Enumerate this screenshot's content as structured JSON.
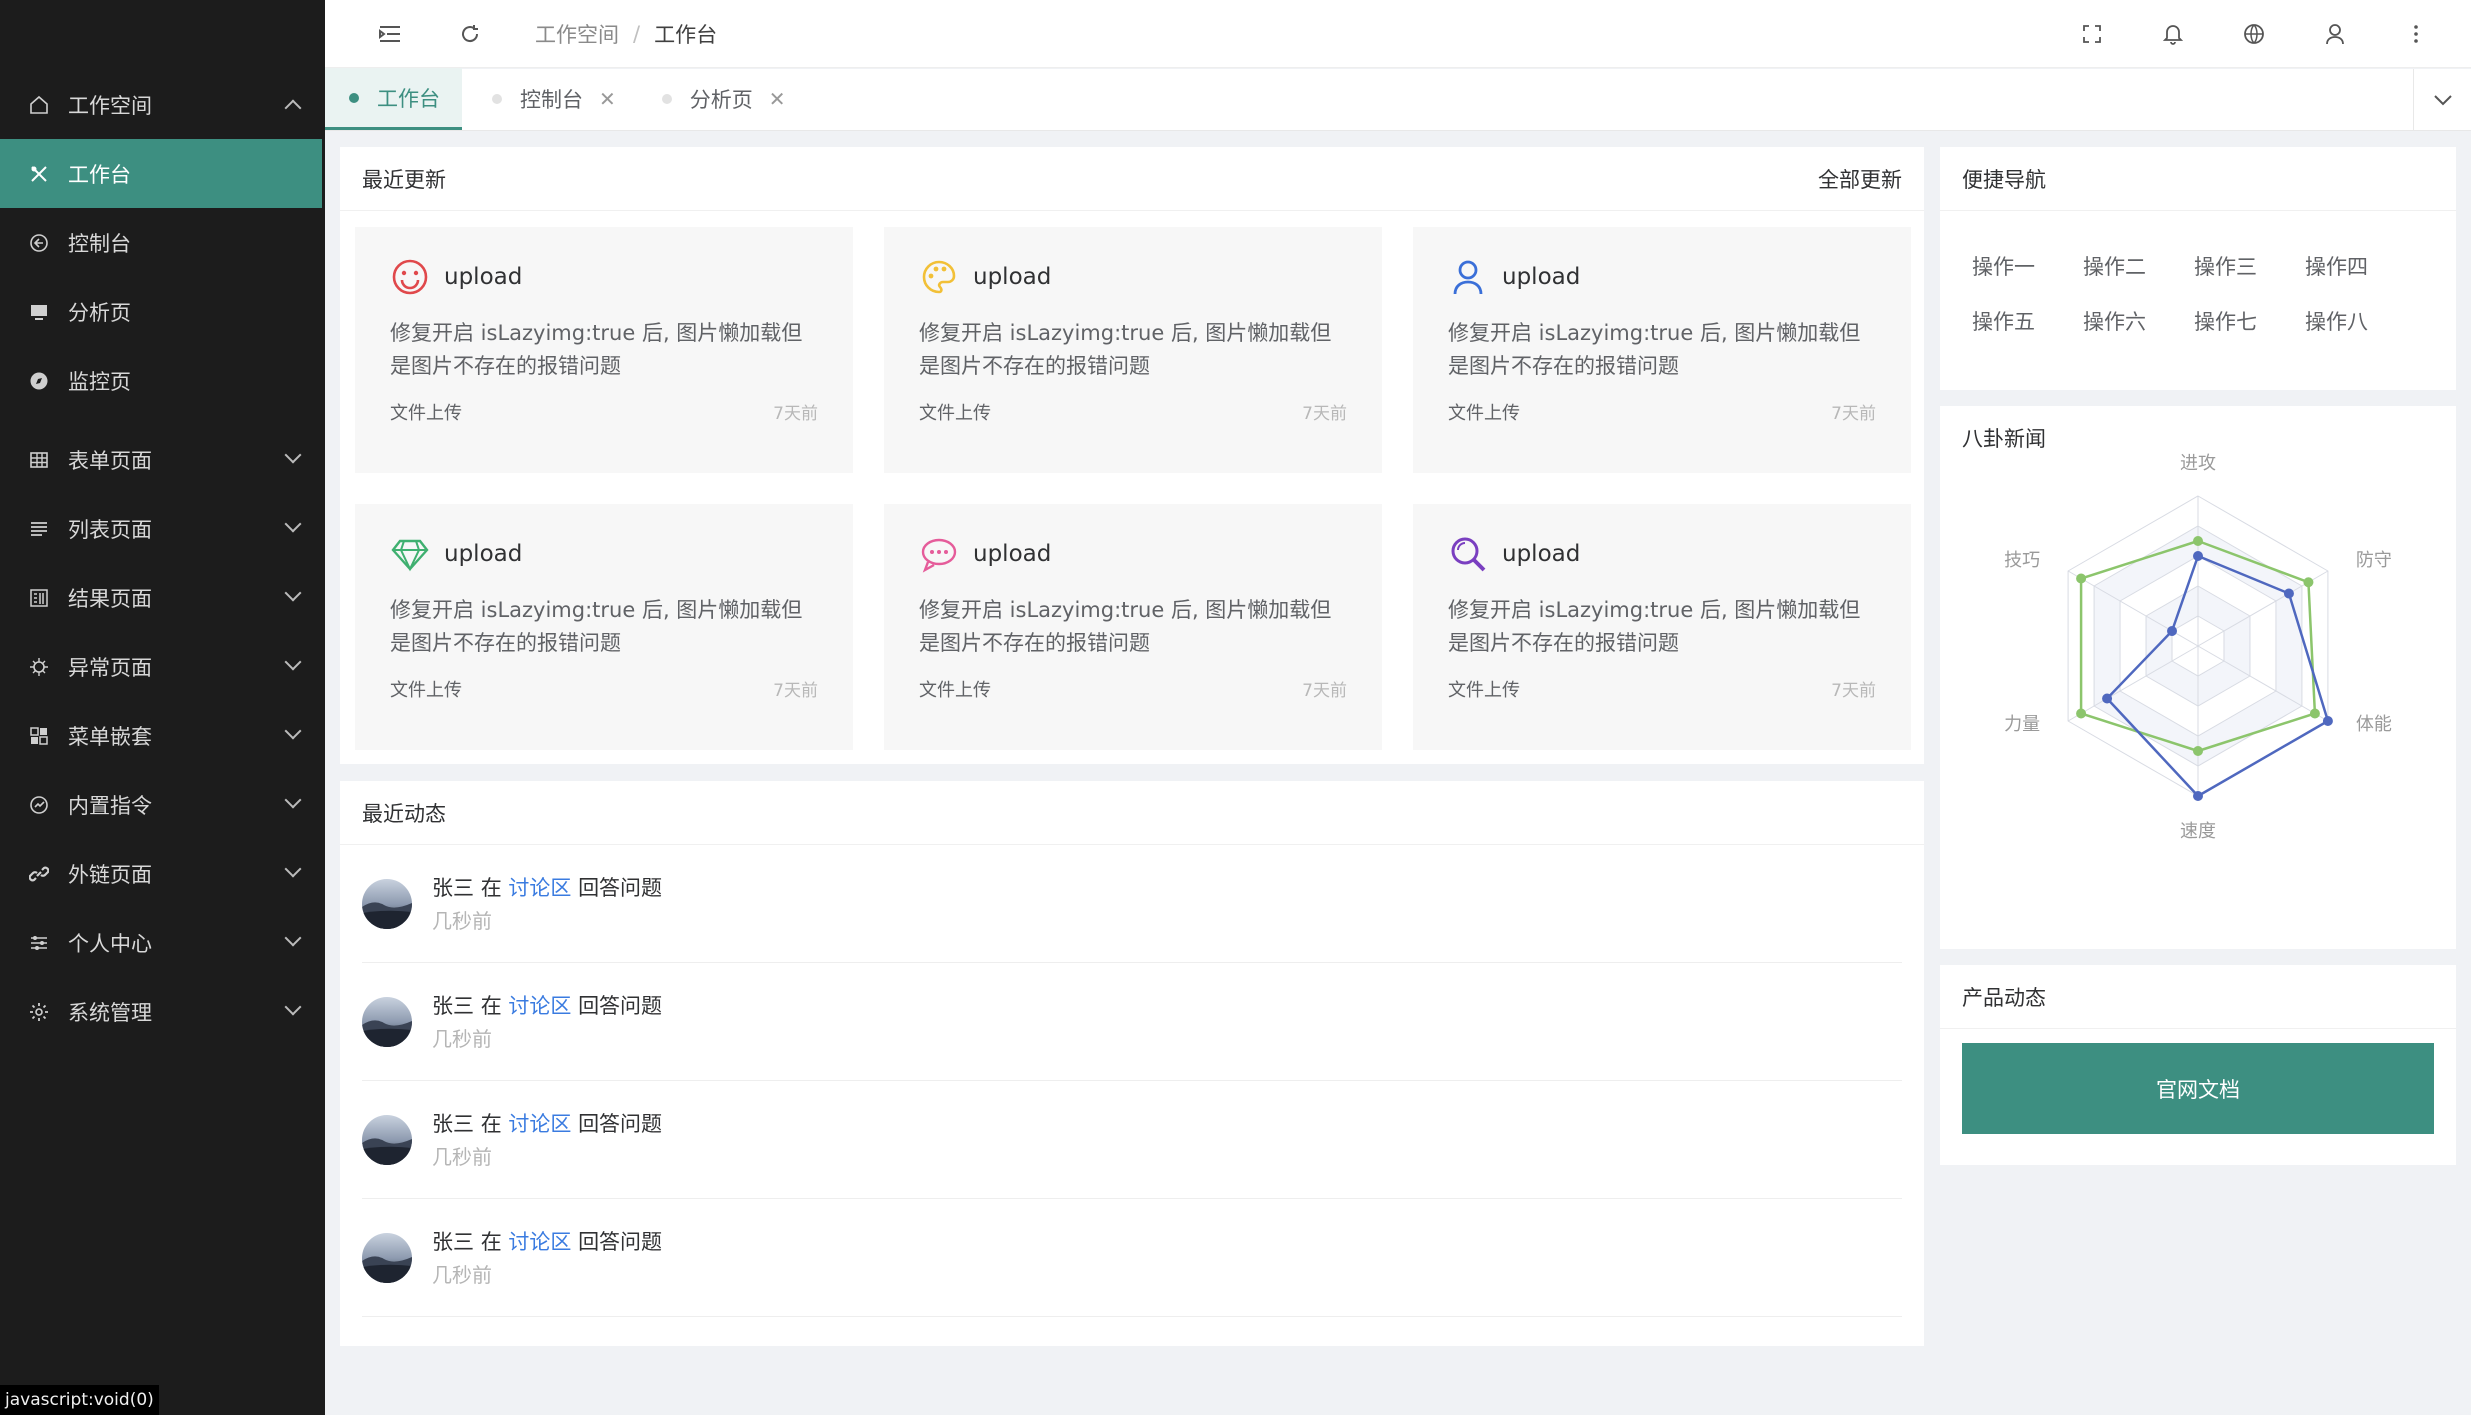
{
  "sidebar": {
    "items": [
      {
        "label": "工作空间",
        "icon": "home-icon",
        "expandable": true,
        "expanded": true
      },
      {
        "label": "工作台",
        "icon": "tools-icon",
        "active": true
      },
      {
        "label": "控制台",
        "icon": "console-icon"
      },
      {
        "label": "分析页",
        "icon": "chart-icon"
      },
      {
        "label": "监控页",
        "icon": "compass-icon"
      },
      {
        "label": "表单页面",
        "icon": "table-icon",
        "expandable": true
      },
      {
        "label": "列表页面",
        "icon": "list-icon",
        "expandable": true
      },
      {
        "label": "结果页面",
        "icon": "result-icon",
        "expandable": true
      },
      {
        "label": "异常页面",
        "icon": "bug-icon",
        "expandable": true
      },
      {
        "label": "菜单嵌套",
        "icon": "apps-icon",
        "expandable": true
      },
      {
        "label": "内置指令",
        "icon": "gauge-icon",
        "expandable": true
      },
      {
        "label": "外链页面",
        "icon": "link-icon",
        "expandable": true
      },
      {
        "label": "个人中心",
        "icon": "sliders-icon",
        "expandable": true
      },
      {
        "label": "系统管理",
        "icon": "settings-icon",
        "expandable": true
      }
    ],
    "status_tip": "javascript:void(0)"
  },
  "header": {
    "breadcrumb": [
      "工作空间",
      "工作台"
    ],
    "icons": [
      "fullscreen-icon",
      "bell-icon",
      "globe-icon",
      "user-icon",
      "more-vertical-icon"
    ]
  },
  "tabs": [
    {
      "label": "工作台",
      "active": true
    },
    {
      "label": "控制台",
      "closable": true
    },
    {
      "label": "分析页",
      "closable": true
    }
  ],
  "recent_updates": {
    "title": "最近更新",
    "extra": "全部更新",
    "cards": [
      {
        "title": "upload",
        "icon": "smile-icon",
        "color": "#e0484b",
        "desc": "修复开启 isLazyimg:true 后, 图片懒加载但是图片不存在的报错问题",
        "source": "文件上传",
        "time": "7天前"
      },
      {
        "title": "upload",
        "icon": "palette-icon",
        "color": "#f2c037",
        "desc": "修复开启 isLazyimg:true 后, 图片懒加载但是图片不存在的报错问题",
        "source": "文件上传",
        "time": "7天前"
      },
      {
        "title": "upload",
        "icon": "person-icon",
        "color": "#3a6fd8",
        "desc": "修复开启 isLazyimg:true 后, 图片懒加载但是图片不存在的报错问题",
        "source": "文件上传",
        "time": "7天前"
      },
      {
        "title": "upload",
        "icon": "diamond-icon",
        "color": "#3fb070",
        "desc": "修复开启 isLazyimg:true 后, 图片懒加载但是图片不存在的报错问题",
        "source": "文件上传",
        "time": "7天前"
      },
      {
        "title": "upload",
        "icon": "chat-icon",
        "color": "#e55c9a",
        "desc": "修复开启 isLazyimg:true 后, 图片懒加载但是图片不存在的报错问题",
        "source": "文件上传",
        "time": "7天前"
      },
      {
        "title": "upload",
        "icon": "search-icon",
        "color": "#7a3fc0",
        "desc": "修复开启 isLazyimg:true 后, 图片懒加载但是图片不存在的报错问题",
        "source": "文件上传",
        "time": "7天前"
      }
    ]
  },
  "recent_activity": {
    "title": "最近动态",
    "items": [
      {
        "user": "张三",
        "prep": "在",
        "link": "讨论区",
        "action": "回答问题",
        "time": "几秒前"
      },
      {
        "user": "张三",
        "prep": "在",
        "link": "讨论区",
        "action": "回答问题",
        "time": "几秒前"
      },
      {
        "user": "张三",
        "prep": "在",
        "link": "讨论区",
        "action": "回答问题",
        "time": "几秒前"
      },
      {
        "user": "张三",
        "prep": "在",
        "link": "讨论区",
        "action": "回答问题",
        "time": "几秒前"
      }
    ]
  },
  "quick_nav": {
    "title": "便捷导航",
    "items": [
      "操作一",
      "操作二",
      "操作三",
      "操作四",
      "操作五",
      "操作六",
      "操作七",
      "操作八"
    ]
  },
  "gossip": {
    "title": "八卦新闻"
  },
  "product": {
    "title": "产品动态",
    "button": "官网文档"
  },
  "chart_data": {
    "type": "radar",
    "indicators": [
      "进攻",
      "防守",
      "体能",
      "速度",
      "力量",
      "技巧"
    ],
    "max": 100,
    "series": [
      {
        "color": "#8cc56c",
        "values": [
          70,
          85,
          90,
          70,
          90,
          90
        ]
      },
      {
        "color": "#4f68bf",
        "values": [
          60,
          70,
          100,
          100,
          70,
          20
        ]
      }
    ],
    "grid": {
      "rings": 5
    },
    "accent": "#3d8f81"
  }
}
